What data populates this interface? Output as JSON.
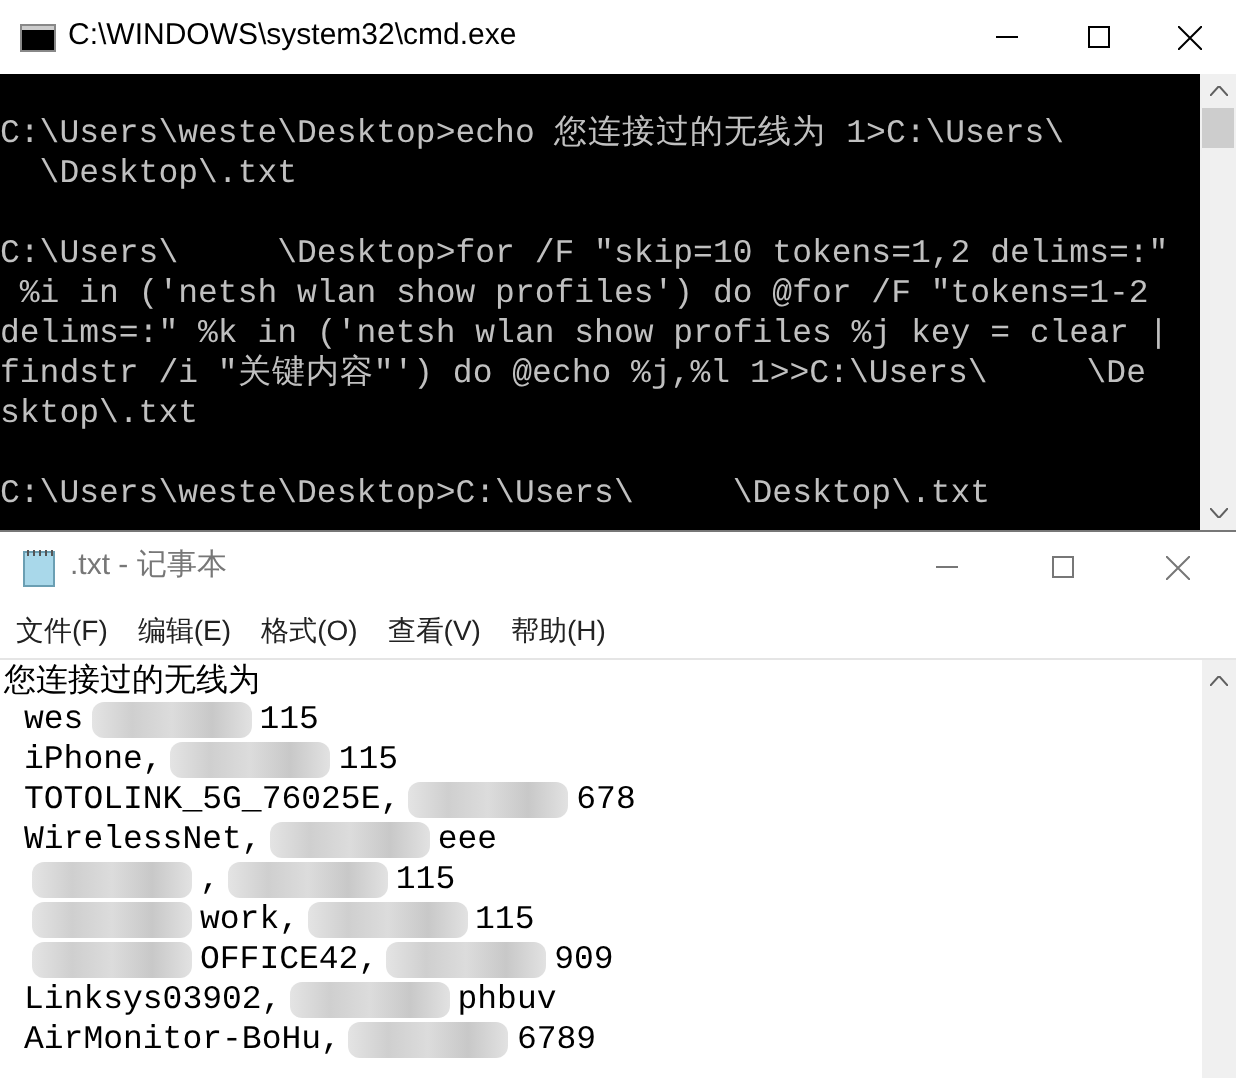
{
  "console_window": {
    "title": "C:\\WINDOWS\\system32\\cmd.exe",
    "blocks": [
      [
        "C:\\Users\\weste\\Desktop>echo 您连接过的无线为 1>C:\\Users\\",
        "  \\Desktop\\.txt"
      ],
      [
        "C:\\Users\\     \\Desktop>for /F \"skip=10 tokens=1,2 delims=:\"",
        " %i in ('netsh wlan show profiles') do @for /F \"tokens=1-2",
        "delims=:\" %k in ('netsh wlan show profiles %j key = clear |",
        "findstr /i \"关键内容\"') do @echo %j,%l 1>>C:\\Users\\     \\De",
        "sktop\\.txt"
      ],
      [
        "C:\\Users\\weste\\Desktop>C:\\Users\\     \\Desktop\\.txt"
      ]
    ]
  },
  "notepad_window": {
    "title": ".txt - 记事本",
    "menu": [
      "文件(F)",
      "编辑(E)",
      "格式(O)",
      "查看(V)",
      "帮助(H)"
    ],
    "heading": "您连接过的无线为",
    "rows": [
      [
        {
          "kind": "text",
          "text": "wes"
        },
        {
          "kind": "redacted"
        },
        {
          "kind": "text",
          "text": "115"
        }
      ],
      [
        {
          "kind": "text",
          "text": "iPhone,"
        },
        {
          "kind": "redacted"
        },
        {
          "kind": "text",
          "text": "115"
        }
      ],
      [
        {
          "kind": "text",
          "text": "TOTOLINK_5G_76025E,"
        },
        {
          "kind": "redacted"
        },
        {
          "kind": "text",
          "text": "678"
        }
      ],
      [
        {
          "kind": "text",
          "text": "WirelessNet,"
        },
        {
          "kind": "redacted"
        },
        {
          "kind": "text",
          "text": "eee"
        }
      ],
      [
        {
          "kind": "redacted"
        },
        {
          "kind": "text",
          "text": ","
        },
        {
          "kind": "redacted"
        },
        {
          "kind": "text",
          "text": "115"
        }
      ],
      [
        {
          "kind": "redacted"
        },
        {
          "kind": "text",
          "text": "work,"
        },
        {
          "kind": "redacted"
        },
        {
          "kind": "text",
          "text": "115"
        }
      ],
      [
        {
          "kind": "redacted"
        },
        {
          "kind": "text",
          "text": "OFFICE42,"
        },
        {
          "kind": "redacted"
        },
        {
          "kind": "text",
          "text": "909"
        }
      ],
      [
        {
          "kind": "text",
          "text": "Linksys03902,"
        },
        {
          "kind": "redacted"
        },
        {
          "kind": "text",
          "text": "phbuv"
        }
      ],
      [
        {
          "kind": "text",
          "text": "AirMonitor-BoHu,"
        },
        {
          "kind": "redacted"
        },
        {
          "kind": "text",
          "text": "6789"
        }
      ]
    ]
  }
}
